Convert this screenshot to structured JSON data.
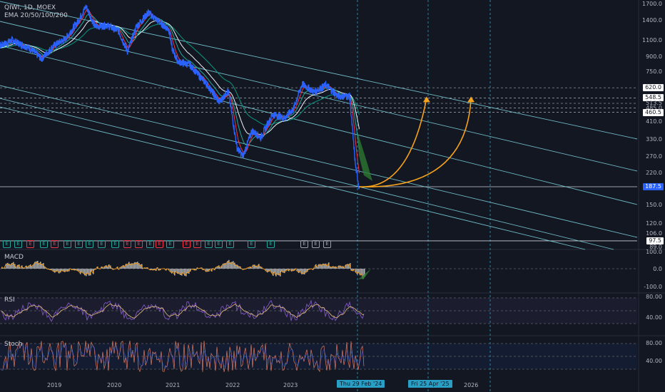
{
  "header": {
    "symbol_line": "QIWI, 1D, MOEX",
    "indicator_line": "EMA 20/50/100/200"
  },
  "panes": {
    "macd": {
      "label": "MACD",
      "ticks": [
        "100.0",
        "0.0",
        "-100.0"
      ]
    },
    "rsi": {
      "label": "RSI",
      "ticks": [
        "80.00",
        "40.00"
      ]
    },
    "stoch": {
      "label": "Stoch",
      "ticks": [
        "80.00",
        "40.00"
      ]
    }
  },
  "price_axis": {
    "ticks": [
      "1700.0",
      "1400.0",
      "1100.0",
      "900.0",
      "750.0",
      "620.0",
      "548.5",
      "513.5",
      "485.0",
      "460.5",
      "410.0",
      "330.0",
      "270.0",
      "220.0",
      "187.5",
      "150.0",
      "120.0",
      "106.0",
      "97.5",
      "89.0"
    ],
    "current_price": "187.5",
    "boxed_levels": [
      "620.0",
      "548.5",
      "460.5",
      "97.5"
    ]
  },
  "time_axis": {
    "labels": [
      "2019",
      "2020",
      "2021",
      "2022",
      "2023",
      "2026"
    ],
    "badges": [
      "Thu 29 Feb '24",
      "Fri 25 Apr '25"
    ]
  },
  "events": {
    "markers": [
      "E",
      "E",
      "E",
      "E",
      "E",
      "E",
      "E",
      "E",
      "E",
      "E",
      "E",
      "E",
      "E",
      "E",
      "E",
      "E",
      "E",
      "E",
      "E",
      "E",
      "E",
      "E",
      "E",
      "E",
      "E"
    ]
  },
  "colors": {
    "background": "#131722",
    "price_line": "#2962ff",
    "ema20": "#f23645",
    "ema50": "#26a69a",
    "ema100": "#f0f3fa",
    "ema200": "#089981",
    "channel": "#7fd6e0",
    "projection": "#f7a21b",
    "rsi_line": "#7e57c2",
    "stoch_k": "#e07a5f",
    "accent": "#2a9fc5"
  },
  "chart_data": {
    "type": "line",
    "x_unit": "year",
    "y_scale": "log",
    "series": [
      {
        "name": "QIWI",
        "x": [
          2018.0,
          2018.3,
          2018.6,
          2018.8,
          2019.0,
          2019.2,
          2019.4,
          2019.55,
          2019.7,
          2019.9,
          2020.1,
          2020.25,
          2020.4,
          2020.6,
          2020.8,
          2020.95,
          2021.0,
          2021.1,
          2021.3,
          2021.6,
          2021.8,
          2021.95,
          2022.1,
          2022.2,
          2022.35,
          2022.5,
          2022.7,
          2022.9,
          2023.05,
          2023.2,
          2023.4,
          2023.6,
          2023.8,
          2024.0,
          2024.1,
          2024.16
        ],
        "y": [
          1000,
          1100,
          1000,
          880,
          1030,
          1120,
          1360,
          1660,
          1300,
          1320,
          1230,
          960,
          1300,
          1540,
          1360,
          1250,
          1000,
          850,
          820,
          640,
          520,
          600,
          300,
          270,
          370,
          340,
          450,
          430,
          480,
          650,
          590,
          640,
          560,
          560,
          240,
          187.5
        ]
      }
    ],
    "projections": [
      {
        "from": [
          2024.16,
          187.5
        ],
        "to": [
          2025.3,
          548.5
        ]
      },
      {
        "from": [
          2024.16,
          187.5
        ],
        "to": [
          2026.05,
          548.5
        ]
      }
    ],
    "horizontal_levels": [
      620.0,
      548.5,
      513.5,
      485.0,
      460.5,
      187.5,
      97.5
    ],
    "ylim": [
      89.0,
      1700.0
    ],
    "grid": true
  }
}
